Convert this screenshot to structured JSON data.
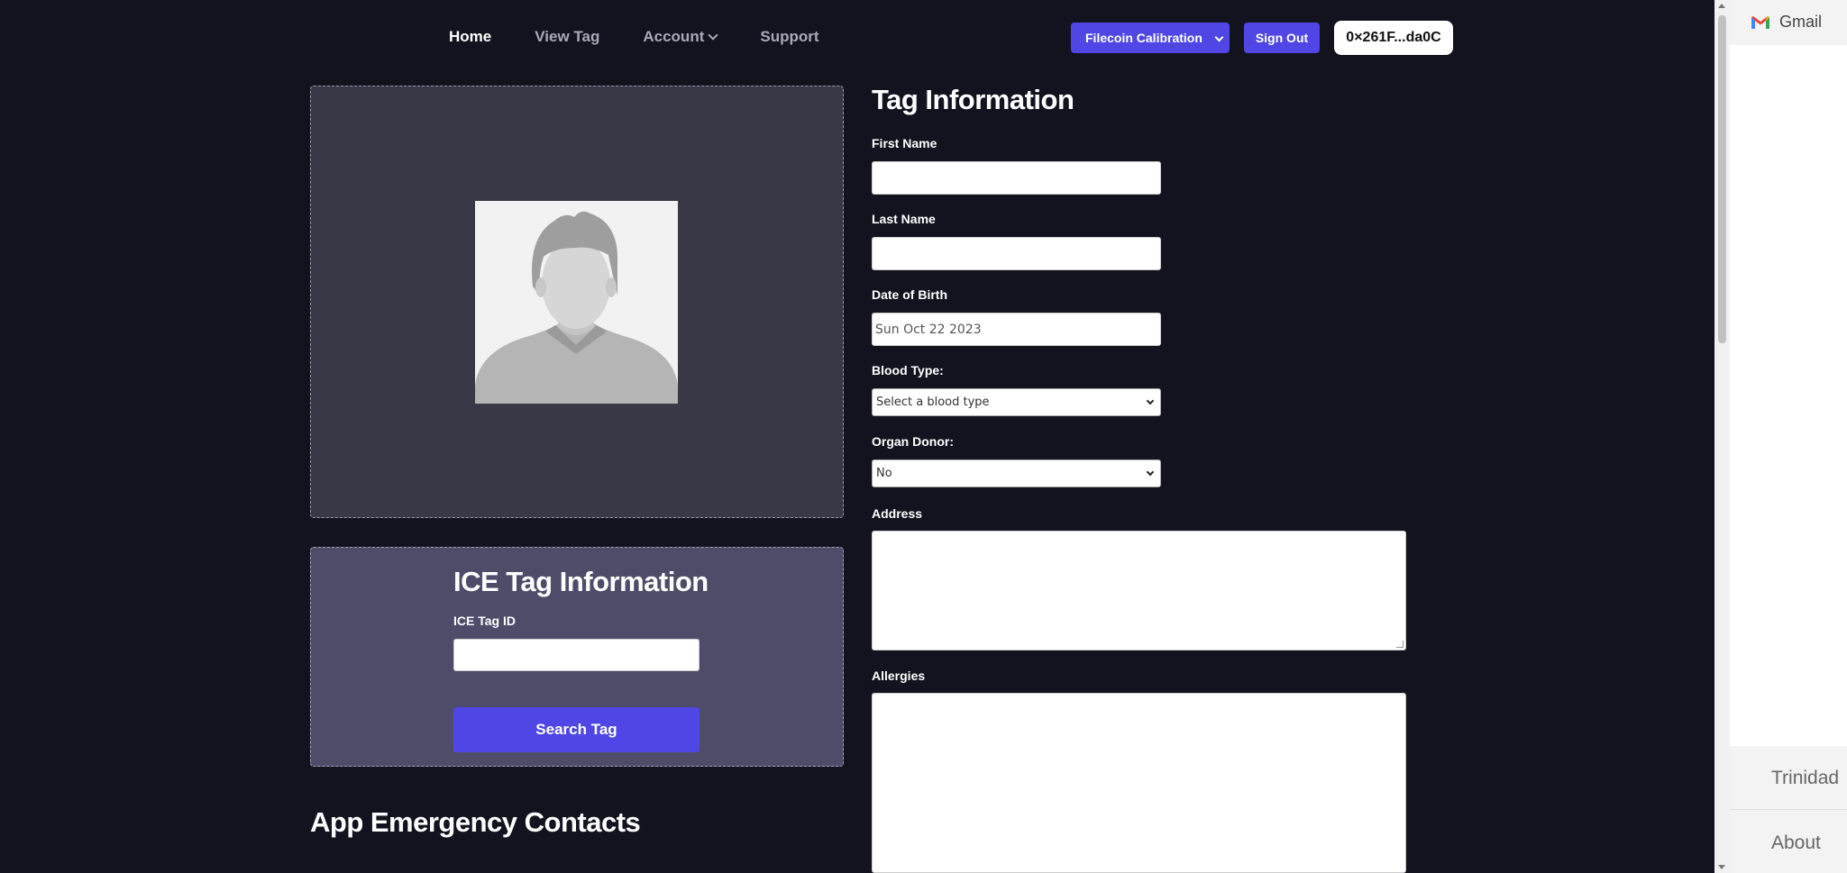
{
  "nav": {
    "items": [
      {
        "label": "Home",
        "active": true
      },
      {
        "label": "View Tag",
        "active": false
      },
      {
        "label": "Account",
        "active": false,
        "has_dropdown": true
      },
      {
        "label": "Support",
        "active": false
      }
    ]
  },
  "header": {
    "network_label": "Filecoin Calibration",
    "signout_label": "Sign Out",
    "wallet_address": "0×261F...da0C"
  },
  "ice": {
    "title": "ICE Tag Information",
    "id_label": "ICE Tag ID",
    "id_value": "",
    "search_label": "Search Tag"
  },
  "contacts": {
    "title": "App Emergency Contacts"
  },
  "form": {
    "title": "Tag Information",
    "first_name_label": "First Name",
    "first_name_value": "",
    "last_name_label": "Last Name",
    "last_name_value": "",
    "dob_label": "Date of Birth",
    "dob_value": "Sun Oct 22 2023",
    "blood_type_label": "Blood Type:",
    "blood_type_value": "Select a blood type",
    "organ_donor_label": "Organ Donor:",
    "organ_donor_value": "No",
    "address_label": "Address",
    "allergies_label": "Allergies"
  },
  "side": {
    "gmail_label": "Gmail",
    "text1": "Trinidad",
    "text2": "About"
  },
  "colors": {
    "background": "#13131f",
    "accent": "#4f46e5",
    "photo_panel": "#383847",
    "ice_panel": "#4e4c69"
  }
}
